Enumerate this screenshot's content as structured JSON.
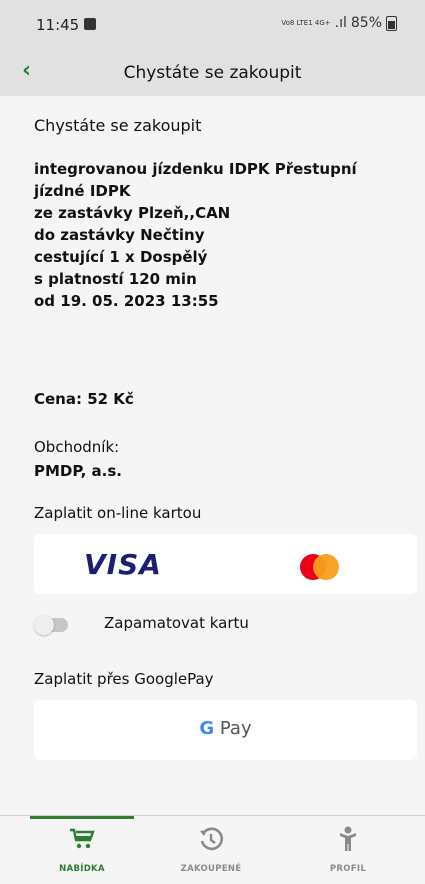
{
  "status_bar": {
    "time": "11:45",
    "network": "Vo8 LTE1 4G+",
    "battery": "85%"
  },
  "header": {
    "title": "Chystáte se zakoupit"
  },
  "summary": {
    "intro": "Chystáte se zakoupit",
    "lines": [
      "integrovanou jízdenku IDPK Přestupní",
      "jízdné IDPK",
      "ze zastávky Plzeň,,CAN",
      "do zastávky Nečtiny",
      "cestující 1 x Dospělý",
      "s platností 120 min",
      "od 19. 05. 2023 13:55"
    ],
    "price": "Cena: 52 Kč",
    "merchant_label": "Obchodník:",
    "merchant": "PMDP, a.s."
  },
  "payment": {
    "card_label": "Zaplatit on-line kartou",
    "visa_text": "VISA",
    "remember_card": "Zapamatovat kartu",
    "remember_card_on": false,
    "googlepay_label": "Zaplatit přes GooglePay",
    "gpay_g": "G",
    "gpay_text": "Pay"
  },
  "bottom_nav": [
    {
      "label": "NABÍDKA",
      "icon": "cart-icon",
      "active": true
    },
    {
      "label": "ZAKOUPENÉ",
      "icon": "history-icon",
      "active": false
    },
    {
      "label": "PROFIL",
      "icon": "person-icon",
      "active": false
    }
  ],
  "colors": {
    "accent": "#2e7d32",
    "bar": "#e1e1e1",
    "background": "#f5f5f5"
  }
}
